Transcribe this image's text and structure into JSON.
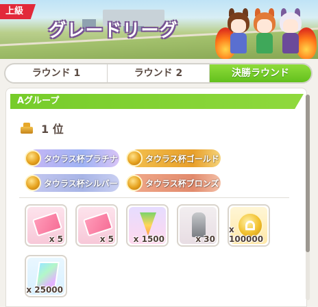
{
  "header": {
    "grade_label": "上級",
    "title": "グレードリーグ"
  },
  "tabs": [
    {
      "label": "ラウンド 1",
      "active": false
    },
    {
      "label": "ラウンド 2",
      "active": false
    },
    {
      "label": "決勝ラウンド",
      "active": true
    }
  ],
  "group": {
    "title": "Aグループ"
  },
  "rank": {
    "label": "1 位"
  },
  "titles": [
    {
      "label": "タウラス杯プラチナ",
      "tier": "platinum"
    },
    {
      "label": "タウラス杯ゴールド",
      "tier": "gold"
    },
    {
      "label": "タウラス杯シルバー",
      "tier": "silver"
    },
    {
      "label": "タウラス杯ブロンズ",
      "tier": "bronze"
    }
  ],
  "rewards": [
    {
      "icon": "ticket-icon",
      "quantity": "x 5"
    },
    {
      "icon": "ticket-icon",
      "quantity": "x 5"
    },
    {
      "icon": "carrot-icon",
      "quantity": "x 1500"
    },
    {
      "icon": "trophy-icon",
      "quantity": "x 30"
    },
    {
      "icon": "coin-icon",
      "quantity": "x 100000"
    },
    {
      "icon": "crystal-icon",
      "quantity": "x 25000"
    }
  ],
  "colors": {
    "accent_green": "#76cc2a",
    "grade_red": "#e2293a",
    "text_brown": "#5a4a42"
  }
}
